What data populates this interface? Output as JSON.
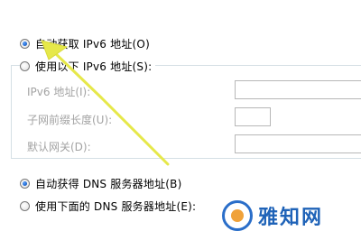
{
  "ipv6": {
    "auto_option": "自动获取 IPv6 地址(O)",
    "manual_option": "使用以下 IPv6 地址(S):",
    "fields": [
      {
        "label": "IPv6 地址(I):",
        "value": ""
      },
      {
        "label": "子网前缀长度(U):",
        "value": ""
      },
      {
        "label": "默认网关(D):",
        "value": ""
      }
    ]
  },
  "dns": {
    "auto_option": "自动获得 DNS 服务器地址(B)",
    "manual_option": "使用下面的 DNS 服务器地址(E):"
  },
  "watermark": {
    "text": "雅知网"
  },
  "colors": {
    "annotation_arrow": "#e6e84a",
    "radio_checked": "#1a5fc6",
    "disabled_text": "#a3a3a3",
    "watermark": "#1f63b8"
  }
}
